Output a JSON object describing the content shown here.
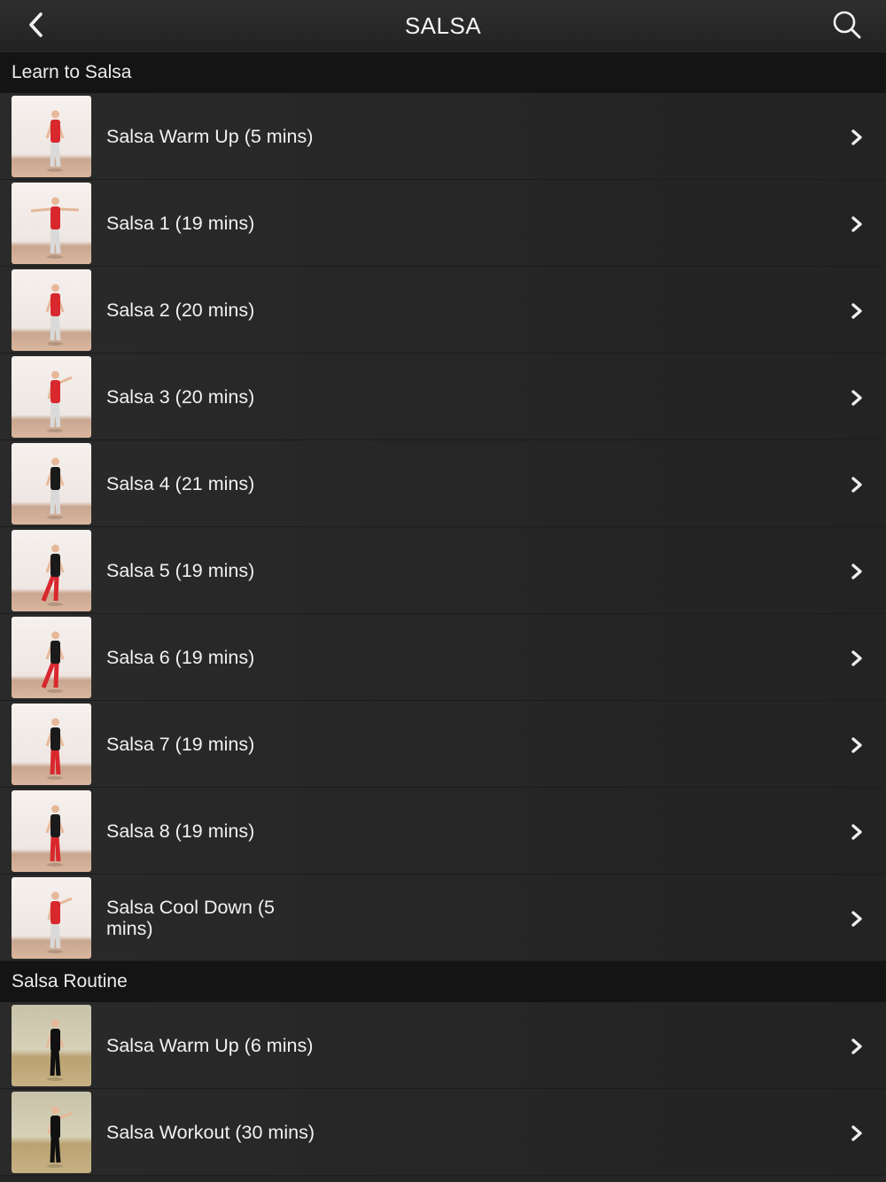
{
  "nav": {
    "title": "SALSA"
  },
  "sections": [
    {
      "title": "Learn to Salsa",
      "items": [
        {
          "label": "Salsa Warm Up (5 mins)",
          "thumb": "studio",
          "shirt": "#d8282e",
          "pants": "#d9d9d9",
          "pose": "stand"
        },
        {
          "label": "Salsa 1 (19 mins)",
          "thumb": "studio",
          "shirt": "#d8282e",
          "pants": "#d9d9d9",
          "pose": "arms-out"
        },
        {
          "label": "Salsa 2 (20 mins)",
          "thumb": "studio",
          "shirt": "#d8282e",
          "pants": "#d9d9d9",
          "pose": "stand"
        },
        {
          "label": "Salsa 3 (20 mins)",
          "thumb": "studio",
          "shirt": "#d8282e",
          "pants": "#d9d9d9",
          "pose": "point"
        },
        {
          "label": "Salsa 4 (21 mins)",
          "thumb": "studio",
          "shirt": "#1a1a1a",
          "pants": "#d9d9d9",
          "pose": "stand"
        },
        {
          "label": "Salsa 5 (19 mins)",
          "thumb": "studio",
          "shirt": "#1a1a1a",
          "pants": "#d8282e",
          "pose": "step"
        },
        {
          "label": "Salsa 6 (19 mins)",
          "thumb": "studio",
          "shirt": "#1a1a1a",
          "pants": "#d8282e",
          "pose": "step"
        },
        {
          "label": "Salsa 7 (19 mins)",
          "thumb": "studio",
          "shirt": "#1a1a1a",
          "pants": "#d8282e",
          "pose": "stand"
        },
        {
          "label": "Salsa 8 (19 mins)",
          "thumb": "studio",
          "shirt": "#1a1a1a",
          "pants": "#d8282e",
          "pose": "stand"
        },
        {
          "label": "Salsa Cool Down (5 mins)",
          "thumb": "studio",
          "shirt": "#d8282e",
          "pants": "#d9d9d9",
          "pose": "point"
        }
      ]
    },
    {
      "title": "Salsa Routine",
      "items": [
        {
          "label": "Salsa Warm Up (6 mins)",
          "thumb": "gym",
          "shirt": "#111111",
          "pants": "#111111",
          "pose": "stand"
        },
        {
          "label": "Salsa Workout (30 mins)",
          "thumb": "gym",
          "shirt": "#111111",
          "pants": "#111111",
          "pose": "point"
        }
      ]
    }
  ],
  "icons": {
    "back": "chevron-left-icon",
    "search": "search-icon",
    "disclosure": "chevron-right-icon"
  }
}
